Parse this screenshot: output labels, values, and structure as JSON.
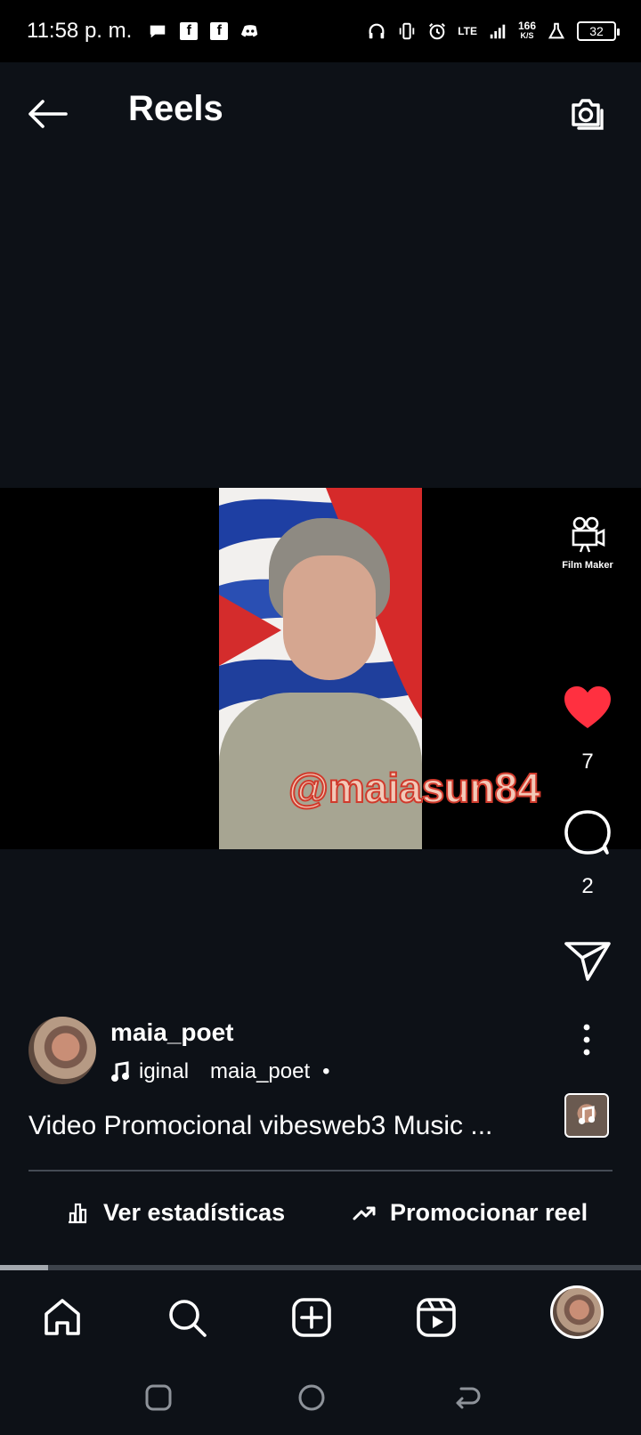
{
  "status_bar": {
    "time": "11:58 p. m.",
    "network": "LTE",
    "speed_value": "166",
    "speed_unit": "K/S",
    "battery": "32"
  },
  "header": {
    "title": "Reels"
  },
  "video": {
    "watermark": "@maiasun84",
    "film_maker_label": "Film Maker"
  },
  "actions": {
    "likes": "7",
    "comments": "2"
  },
  "author": {
    "username": "maia_poet",
    "audio_name": "iginal",
    "audio_author": "maia_poet",
    "separator": "•"
  },
  "caption": "Video Promocional vibesweb3 Music ...",
  "buttons": {
    "stats": "Ver estadísticas",
    "promote": "Promocionar reel"
  },
  "playback": {
    "progress_fraction": 0.075
  },
  "colors": {
    "background": "#0d1117",
    "like": "#ff3040",
    "watermark_fill": "#f3c9b8",
    "watermark_stroke": "#d03a2c"
  }
}
